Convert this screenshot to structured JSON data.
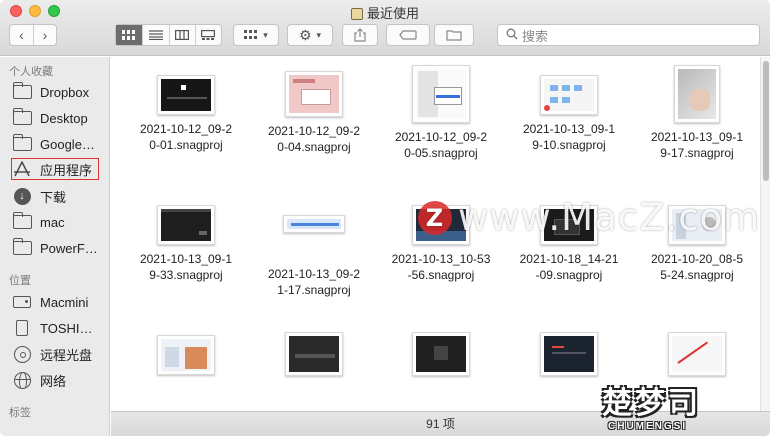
{
  "window": {
    "title": "最近使用"
  },
  "toolbar": {
    "back": "‹",
    "forward": "›",
    "search_placeholder": "搜索"
  },
  "sidebar": {
    "favorites_header": "个人收藏",
    "favorites": [
      {
        "label": "Dropbox",
        "icon": "folder-icon"
      },
      {
        "label": "Desktop",
        "icon": "folder-icon"
      },
      {
        "label": "Google…",
        "icon": "folder-icon"
      },
      {
        "label": "应用程序",
        "icon": "applications-icon"
      },
      {
        "label": "下载",
        "icon": "download-icon"
      },
      {
        "label": "mac",
        "icon": "folder-icon"
      },
      {
        "label": "PowerF…",
        "icon": "folder-icon"
      }
    ],
    "locations_header": "位置",
    "locations": [
      {
        "label": "Macmini",
        "icon": "drive-icon"
      },
      {
        "label": "TOSHI…",
        "icon": "usb-drive-icon"
      },
      {
        "label": "远程光盘",
        "icon": "disc-icon"
      },
      {
        "label": "网络",
        "icon": "globe-icon"
      }
    ],
    "tags_header": "标签"
  },
  "files": {
    "row1": [
      {
        "line1": "2021-10-12_09-2",
        "line2": "0-01.snagproj"
      },
      {
        "line1": "2021-10-12_09-2",
        "line2": "0-04.snagproj"
      },
      {
        "line1": "2021-10-12_09-2",
        "line2": "0-05.snagproj"
      },
      {
        "line1": "2021-10-13_09-1",
        "line2": "9-10.snagproj"
      },
      {
        "line1": "2021-10-13_09-1",
        "line2": "9-17.snagproj"
      }
    ],
    "row2": [
      {
        "line1": "2021-10-13_09-1",
        "line2": "9-33.snagproj"
      },
      {
        "line1": "2021-10-13_09-2",
        "line2": "1-17.snagproj"
      },
      {
        "line1": "2021-10-13_10-53",
        "line2": "-56.snagproj"
      },
      {
        "line1": "2021-10-18_14-21",
        "line2": "-09.snagproj"
      },
      {
        "line1": "2021-10-20_08-5",
        "line2": "5-24.snagproj"
      }
    ]
  },
  "status": {
    "item_count": "91 项"
  },
  "watermarks": {
    "macz_z": "Z",
    "macz_text": "www.MacZ.com",
    "brand_big": "楚梦司",
    "brand_small": "CHUMENGSI"
  }
}
